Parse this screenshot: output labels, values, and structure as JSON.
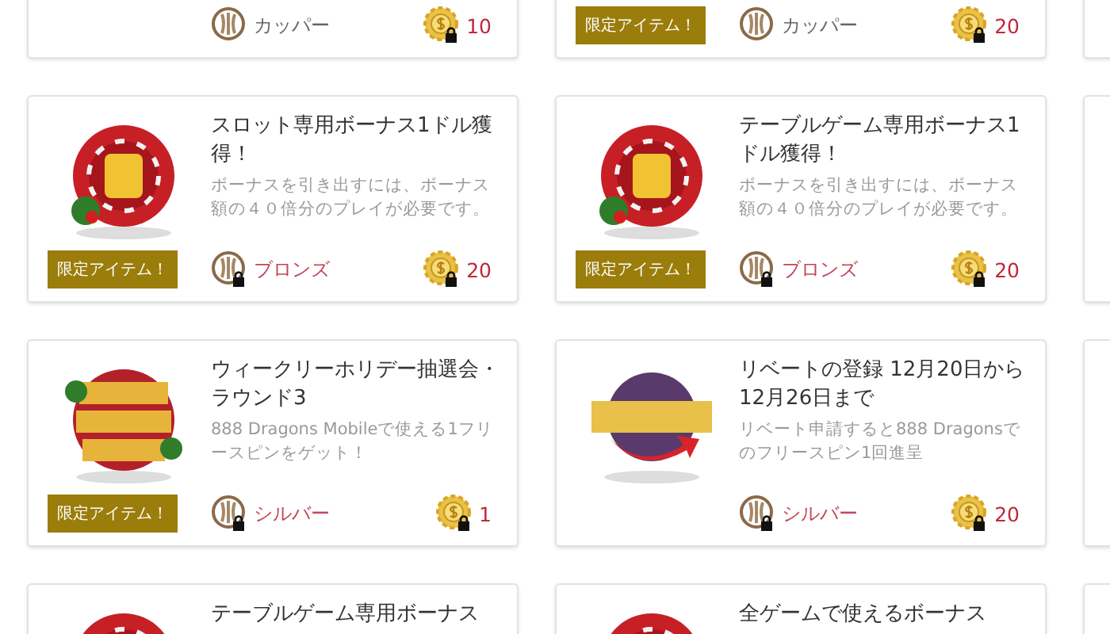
{
  "cards": [
    {
      "kind": "chip",
      "tier": {
        "label": "カッパー",
        "locked": false
      },
      "points": {
        "value": "10",
        "locked": true
      }
    },
    {
      "kind": "chip",
      "badge": "限定アイテム！",
      "tier": {
        "label": "カッパー",
        "locked": false
      },
      "points": {
        "value": "20",
        "locked": true
      }
    },
    {
      "kind": "chip",
      "title": "スロット専用ボーナス1ドル獲得！",
      "description": "ボーナスを引き出すには、ボーナス額の４０倍分のプレイが必要です。",
      "badge": "限定アイテム！",
      "tier": {
        "label": "ブロンズ",
        "locked": true
      },
      "points": {
        "value": "20",
        "locked": true
      }
    },
    {
      "kind": "chip",
      "title": "テーブルゲーム専用ボーナス1ドル獲得！",
      "description": "ボーナスを引き出すには、ボーナス額の４０倍分のプレイが必要です。",
      "badge": "限定アイテム！",
      "tier": {
        "label": "ブロンズ",
        "locked": true
      },
      "points": {
        "value": "20",
        "locked": true
      }
    },
    {
      "kind": "raffle",
      "title": "ウィークリーホリデー抽選会・ラウンド3",
      "description": "888 Dragons Mobileで使える1フリースピンをゲット！",
      "badge": "限定アイテム！",
      "tier": {
        "label": "シルバー",
        "locked": true
      },
      "points": {
        "value": "1",
        "locked": true
      }
    },
    {
      "kind": "rebates",
      "title": "リベートの登録 12月20日から12月26日まで",
      "description": "リベート申請すると888 Dragonsでのフリースピン1回進呈",
      "tier": {
        "label": "シルバー",
        "locked": true
      },
      "points": {
        "value": "20",
        "locked": true
      }
    },
    {
      "kind": "chip",
      "title": "テーブルゲーム専用ボーナス"
    },
    {
      "kind": "chip",
      "title": "全ゲームで使えるボーナス"
    }
  ]
}
